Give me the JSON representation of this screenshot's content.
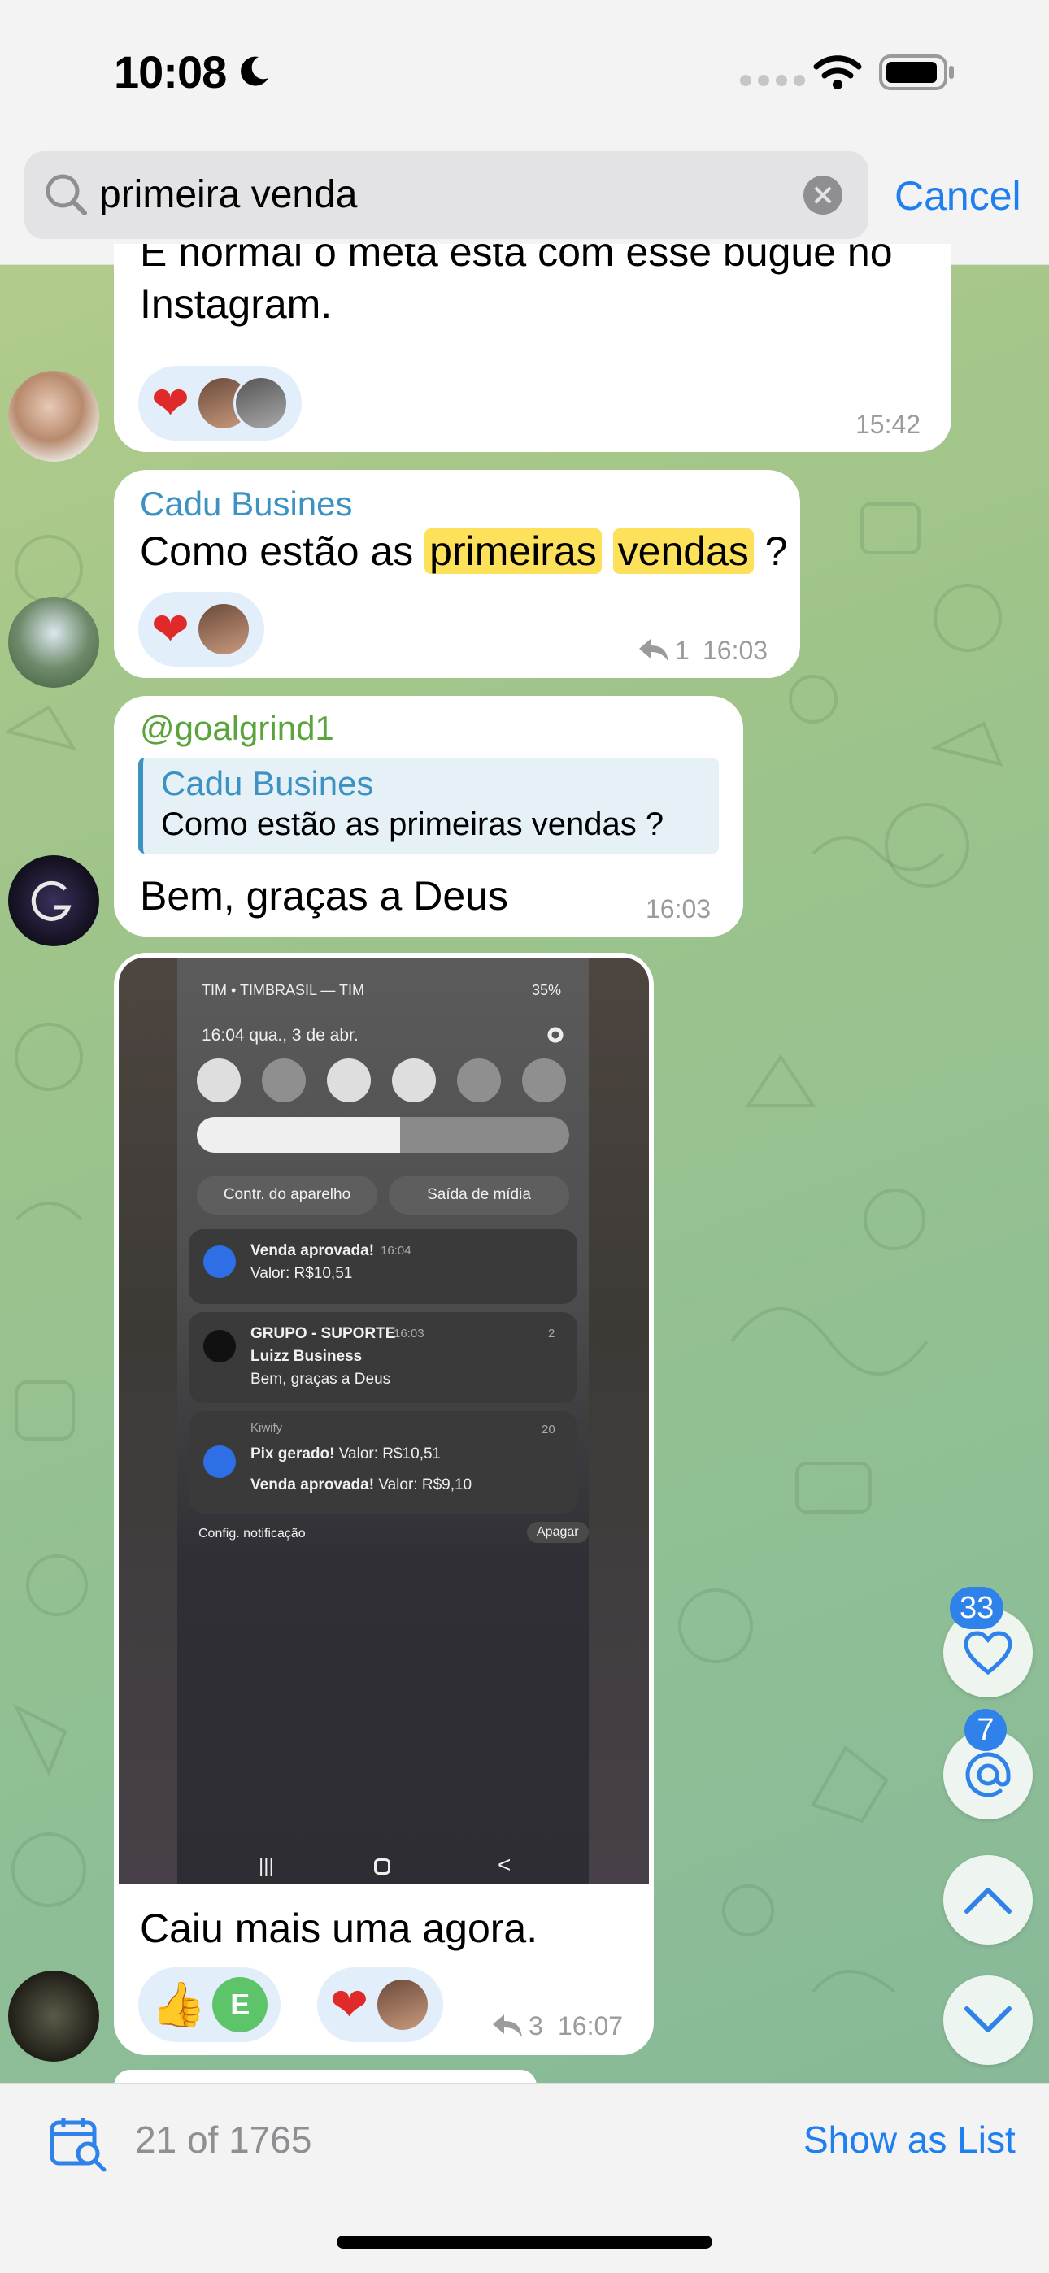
{
  "status_bar": {
    "time": "10:08"
  },
  "search": {
    "query": "primeira venda",
    "cancel_label": "Cancel"
  },
  "messages": [
    {
      "text_line1": "É normal o meta esta com esse bugue no",
      "text_line2": "Instagram.",
      "time": "15:42"
    },
    {
      "sender": "Cadu Busines",
      "text_pre": "Como estão as ",
      "hl1": "primeiras",
      "hl2": "vendas",
      "text_post": " ?",
      "replies": "1",
      "time": "16:03"
    },
    {
      "sender": "@goalgrind1",
      "quote_sender": "Cadu Busines",
      "quote_text": "Como estão as primeiras vendas ?",
      "text": "Bem, graças a Deus",
      "time": "16:03"
    },
    {
      "text": "Caiu mais uma agora.",
      "reaction_letter": "E",
      "replies": "3",
      "time": "16:07"
    }
  ],
  "phone_screenshot": {
    "carrier": "TIM • TIMBRASIL — TIM",
    "battery": "35%",
    "datetime": "16:04  qua., 3 de abr.",
    "btn_device": "Contr. do aparelho",
    "btn_media": "Saída de mídia",
    "notif1_title": "Venda aprovada!",
    "notif1_time": "16:04",
    "notif1_body": "Valor: R$10,51",
    "notif2_title": "GRUPO - SUPORTE",
    "notif2_time": "16:03",
    "notif2_count": "2",
    "notif2_sender": "Luizz Business",
    "notif2_body": "Bem, graças a Deus",
    "notif3_app": "Kiwify",
    "notif3_count": "20",
    "notif3_line1_bold": "Pix gerado!",
    "notif3_line1": " Valor: R$10,51",
    "notif3_line2_bold": "Venda aprovada!",
    "notif3_line2": " Valor: R$9,10",
    "config_label": "Config. notificação",
    "clear_label": "Apagar"
  },
  "floating": {
    "reactions_count": "33",
    "mentions_count": "7"
  },
  "bottom_bar": {
    "counter": "21 of 1765",
    "show_list_label": "Show as List"
  }
}
